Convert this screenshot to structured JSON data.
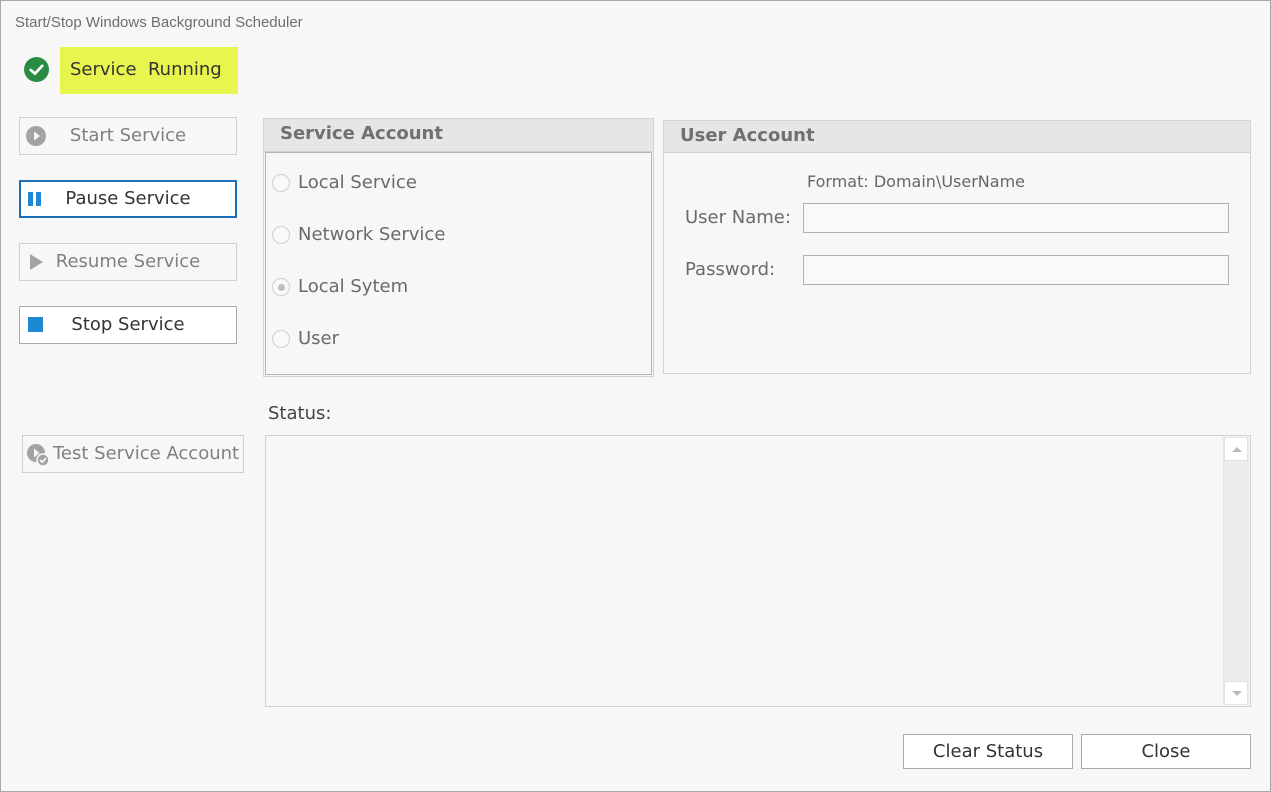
{
  "window": {
    "title": "Start/Stop Windows Background Scheduler"
  },
  "service_status": {
    "icon": "check-circle-icon",
    "text": "Service  Running",
    "highlight_color": "#e8f54f",
    "icon_color": "#2a8b45"
  },
  "actions": {
    "start": {
      "label": "Start Service",
      "icon": "play-circle-icon",
      "enabled": false
    },
    "pause": {
      "label": "Pause Service",
      "icon": "pause-icon",
      "enabled": true,
      "focused": true
    },
    "resume": {
      "label": "Resume Service",
      "icon": "play-icon",
      "enabled": false
    },
    "stop": {
      "label": "Stop Service",
      "icon": "stop-icon",
      "enabled": true
    },
    "test": {
      "label": "Test Service Account",
      "icon": "play-check-icon",
      "enabled": false
    }
  },
  "service_account": {
    "header": "Service Account",
    "options": [
      {
        "label": "Local Service",
        "checked": false
      },
      {
        "label": "Network Service",
        "checked": false
      },
      {
        "label": "Local Sytem",
        "checked": true
      },
      {
        "label": "User",
        "checked": false
      }
    ]
  },
  "user_account": {
    "header": "User Account",
    "format_hint": "Format: Domain\\UserName",
    "username_label": "User Name:",
    "username_value": "",
    "password_label": "Password:",
    "password_value": ""
  },
  "status": {
    "label": "Status:",
    "text": ""
  },
  "footer": {
    "clear_label": "Clear Status",
    "close_label": "Close"
  },
  "colors": {
    "accent": "#1b70b7",
    "stop_icon": "#1e88d2"
  }
}
